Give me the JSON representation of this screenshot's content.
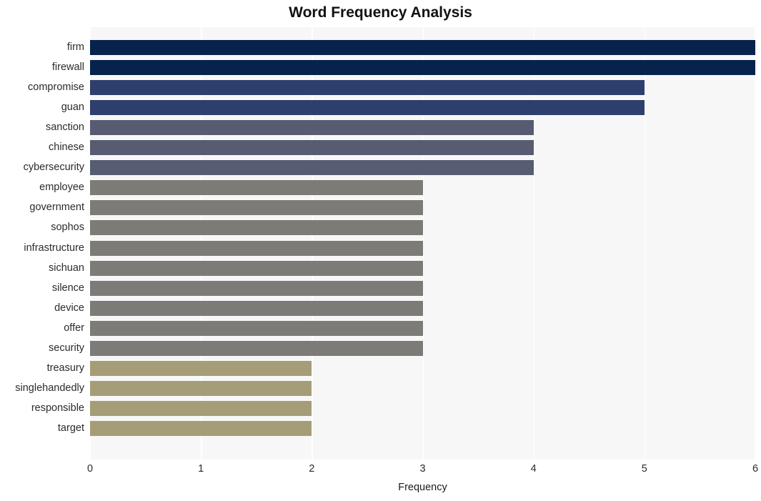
{
  "chart_data": {
    "type": "bar",
    "orientation": "horizontal",
    "title": "Word Frequency Analysis",
    "xlabel": "Frequency",
    "ylabel": "",
    "categories": [
      "firm",
      "firewall",
      "compromise",
      "guan",
      "sanction",
      "chinese",
      "cybersecurity",
      "employee",
      "government",
      "sophos",
      "infrastructure",
      "sichuan",
      "silence",
      "device",
      "offer",
      "security",
      "treasury",
      "singlehandedly",
      "responsible",
      "target"
    ],
    "values": [
      6,
      6,
      5,
      5,
      4,
      4,
      4,
      3,
      3,
      3,
      3,
      3,
      3,
      3,
      3,
      3,
      2,
      2,
      2,
      2
    ],
    "bar_colors": [
      "#07224d",
      "#07224d",
      "#2e3f6d",
      "#2e3f6d",
      "#575c72",
      "#575c72",
      "#575c72",
      "#7c7b78",
      "#7c7b78",
      "#7c7b78",
      "#7c7b78",
      "#7c7b78",
      "#7c7b78",
      "#7c7b78",
      "#7c7b78",
      "#7c7b78",
      "#a49d77",
      "#a49d77",
      "#a49d77",
      "#a49d77"
    ],
    "xlim": [
      0,
      6
    ],
    "xticks": [
      0,
      1,
      2,
      3,
      4,
      5,
      6
    ],
    "xtick_labels": [
      "0",
      "1",
      "2",
      "3",
      "4",
      "5",
      "6"
    ],
    "grid": {
      "vertical": true,
      "horizontal": false,
      "color": "#ffffff"
    },
    "legend": null,
    "plot_background": "#f7f7f7",
    "figure_background": "#ffffff",
    "title_color": "#111111",
    "tick_color": "#2b2b2b"
  }
}
